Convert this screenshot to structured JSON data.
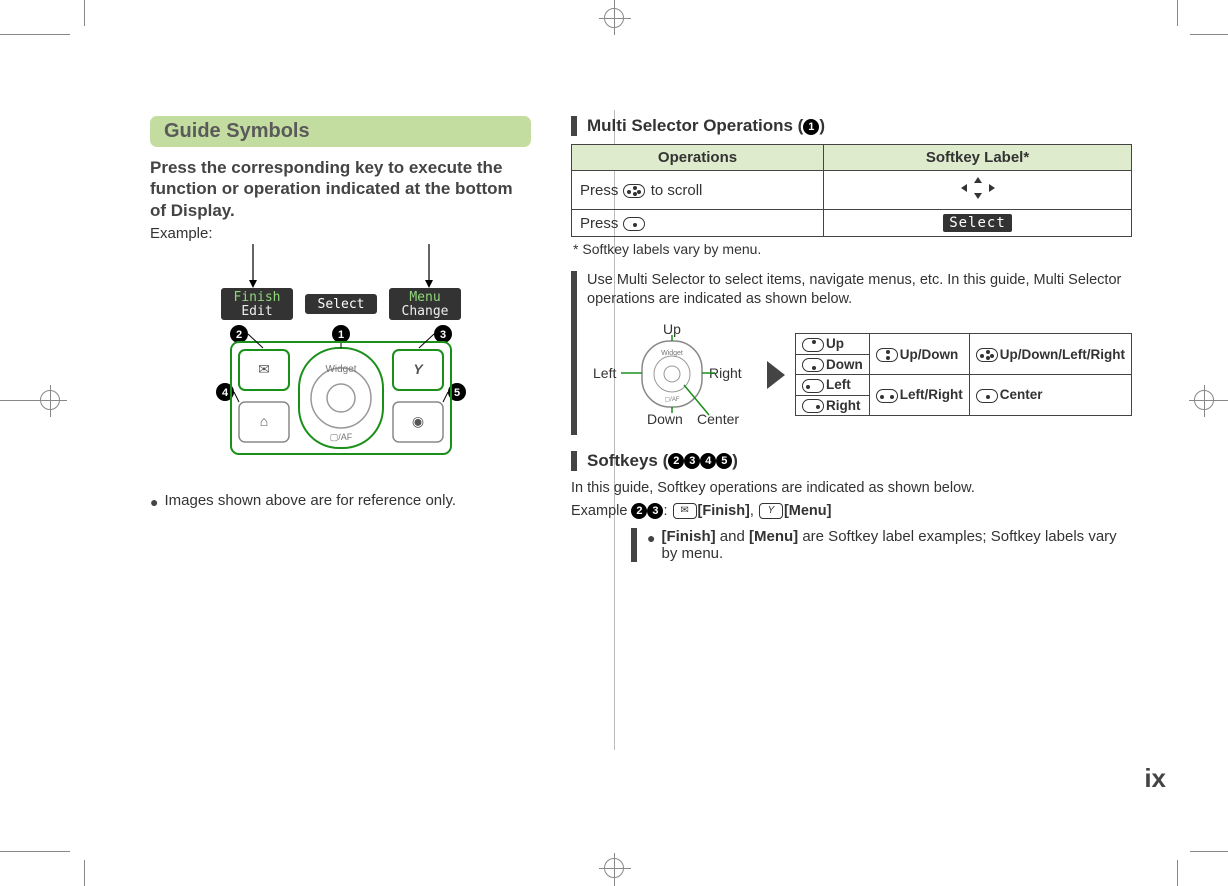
{
  "page_number": "ix",
  "left": {
    "section_title": "Guide Symbols",
    "intro": "Press the corresponding key to execute the function or operation indicated at the bottom of Display.",
    "example_label": "Example:",
    "softkey_labels": {
      "left_top": "Finish",
      "left_bottom": "Edit",
      "center": "Select",
      "right_top": "Menu",
      "right_bottom": "Change"
    },
    "widget_label": "Widget",
    "ref_note": "Images shown above are for reference only."
  },
  "right": {
    "multi_selector": {
      "heading_prefix": "Multi Selector Operations (",
      "heading_suffix": ")",
      "marker": "1",
      "table": {
        "col1": "Operations",
        "col2": "Softkey Label*",
        "row1_text": "Press ",
        "row1_suffix": " to scroll",
        "row2_text": "Press ",
        "row2_label": "Select"
      },
      "footnote": "* Softkey labels vary by menu.",
      "guide_intro": "Use Multi Selector to select items, navigate menus, etc. In this guide, Multi Selector operations are indicated as shown below.",
      "labels": {
        "up": "Up",
        "down": "Down",
        "left": "Left",
        "right": "Right",
        "center": "Center"
      },
      "dirs": {
        "up": "Up",
        "down": "Down",
        "left": "Left",
        "right": "Right",
        "updown": "Up/Down",
        "leftright": "Left/Right",
        "all": "Up/Down/Left/Right",
        "center": "Center"
      }
    },
    "softkeys": {
      "heading_prefix": "Softkeys (",
      "heading_suffix": ")",
      "markers": "2345",
      "line1": "In this guide, Softkey operations are indicated as shown below.",
      "example_prefix": "Example ",
      "example_markers": "23",
      "example_sep": ": ",
      "finish_label": "[Finish]",
      "menu_label": "[Menu]",
      "note_bold1": "[Finish]",
      "note_mid": " and ",
      "note_bold2": "[Menu]",
      "note_rest": " are Softkey label examples; Softkey labels vary by menu."
    }
  }
}
